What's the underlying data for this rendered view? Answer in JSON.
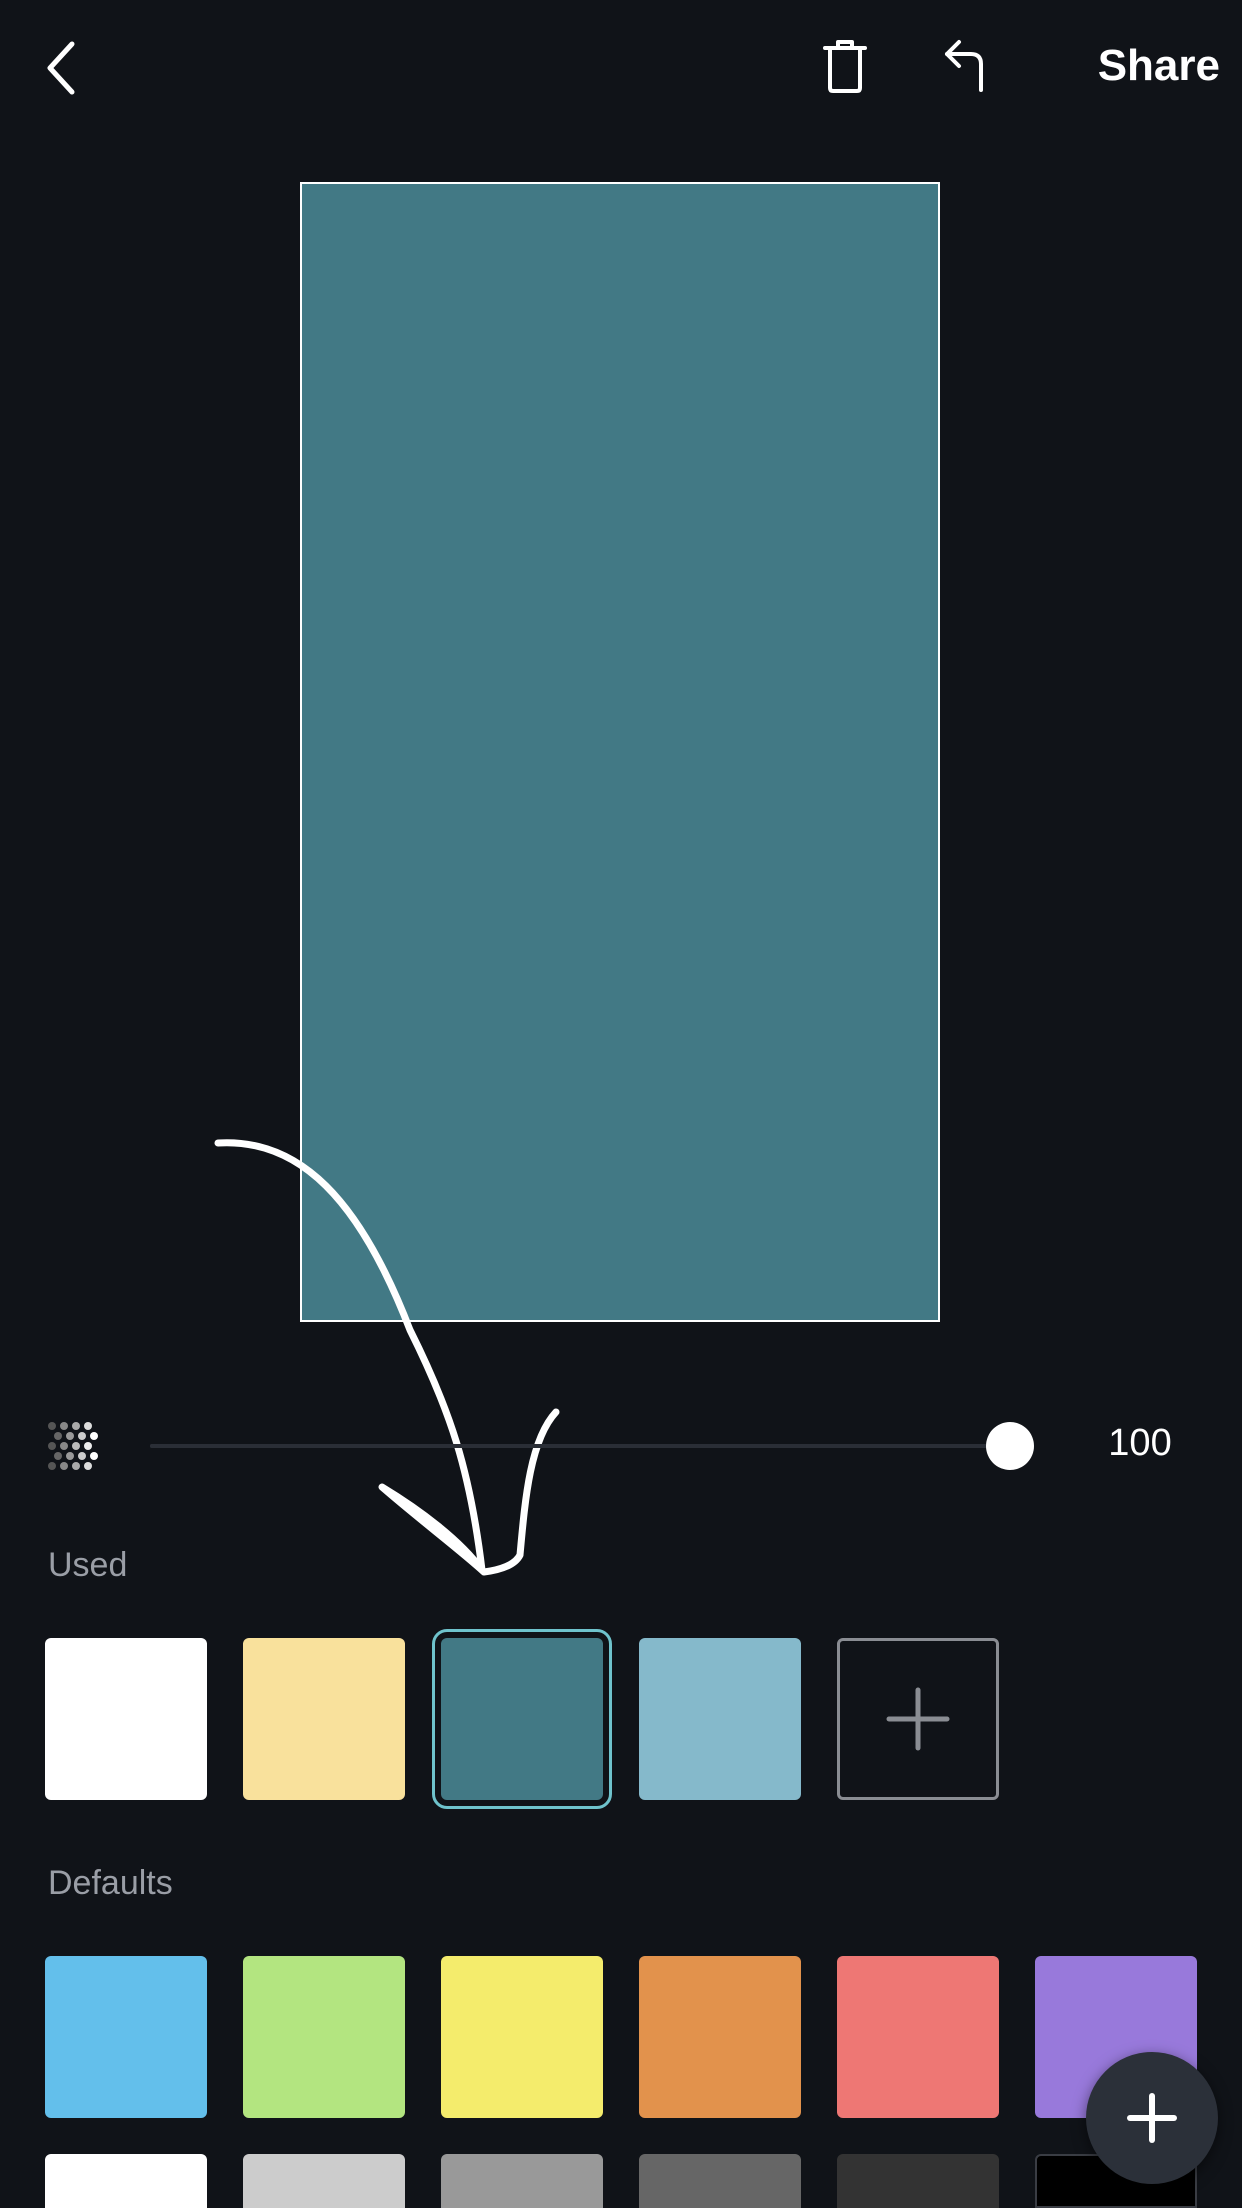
{
  "toolbar": {
    "back_icon": "chevron-left-icon",
    "trash_icon": "trash-icon",
    "undo_icon": "undo-icon",
    "share_label": "Share"
  },
  "canvas": {
    "fill_color": "#427985",
    "border_color": "#ffffff",
    "drawing_color": "#ffffff"
  },
  "opacity": {
    "icon": "opacity-dots-icon",
    "value": "100",
    "level": 1.0
  },
  "used": {
    "label": "Used",
    "swatches": [
      {
        "color": "#ffffff",
        "selected": false
      },
      {
        "color": "#f9e19c",
        "selected": false
      },
      {
        "color": "#427985",
        "selected": true
      },
      {
        "color": "#85b9cb",
        "selected": false
      }
    ],
    "add_icon": "plus-icon"
  },
  "defaults": {
    "label": "Defaults",
    "row1": [
      "#63bfeb",
      "#b3e580",
      "#f4ec6c",
      "#e2924c",
      "#ee7774",
      "#9879db"
    ],
    "row2": [
      "#ffffff",
      "#cccccc",
      "#999999",
      "#666666",
      "#333333",
      "#000000"
    ]
  },
  "fab": {
    "icon": "plus-icon"
  }
}
